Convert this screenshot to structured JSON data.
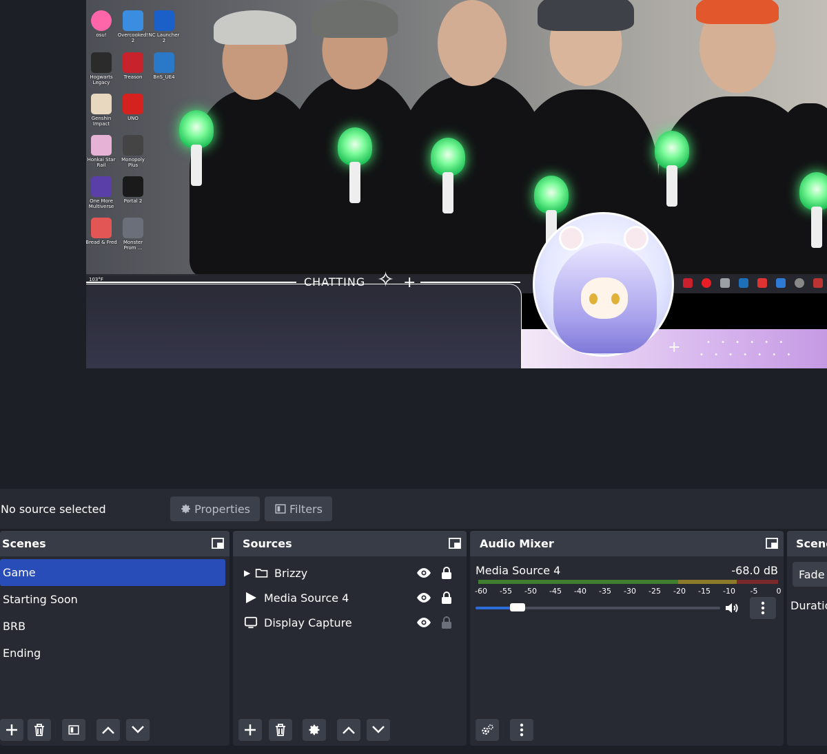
{
  "preview": {
    "desktop_icons": [
      {
        "label": "osu!"
      },
      {
        "label": "Overcooked! 2"
      },
      {
        "label": "NC Launcher 2"
      },
      {
        "label": "Hogwarts Legacy"
      },
      {
        "label": "Treason"
      },
      {
        "label": "BnS_UE4"
      },
      {
        "label": "Genshin Impact"
      },
      {
        "label": "UNO"
      },
      {
        "label": "Honkai Star Rail"
      },
      {
        "label": "Monopoly Plus"
      },
      {
        "label": "One More Multiverse"
      },
      {
        "label": "Portal 2"
      },
      {
        "label": "Bread & Fred"
      },
      {
        "label": "Monster Prom ..."
      }
    ],
    "overlay_label": "CHATTING",
    "weather": "103°F"
  },
  "source_bar": {
    "status": "No source selected",
    "properties_label": "Properties",
    "filters_label": "Filters"
  },
  "scenes": {
    "title": "Scenes",
    "items": [
      {
        "label": "Game",
        "active": true
      },
      {
        "label": "Starting Soon",
        "active": false
      },
      {
        "label": "BRB",
        "active": false
      },
      {
        "label": "Ending",
        "active": false
      }
    ]
  },
  "sources": {
    "title": "Sources",
    "items": [
      {
        "label": "Brizzy",
        "type": "folder-icon",
        "visible": true,
        "locked": true
      },
      {
        "label": "Media Source 4",
        "type": "play-icon",
        "visible": true,
        "locked": true
      },
      {
        "label": "Display Capture",
        "type": "monitor-icon",
        "visible": true,
        "locked": false
      }
    ]
  },
  "audio_mixer": {
    "title": "Audio Mixer",
    "channel_name": "Media Source 4",
    "level": "-68.0 dB",
    "ticks": [
      "-60",
      "-55",
      "-50",
      "-45",
      "-40",
      "-35",
      "-30",
      "-25",
      "-20",
      "-15",
      "-10",
      "-5",
      "0"
    ],
    "volume_fraction": 0.14
  },
  "scene_transitions": {
    "title": "Scene",
    "transition": "Fade",
    "duration_label": "Duratio"
  },
  "colors": {
    "accent": "#284cb8",
    "panel": "#272a33",
    "header": "#383c47",
    "button": "#3c404b"
  }
}
